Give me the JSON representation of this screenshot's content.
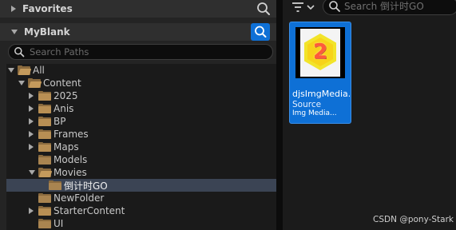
{
  "favorites": {
    "title": "Favorites"
  },
  "myblank": {
    "title": "MyBlank"
  },
  "path_search": {
    "placeholder": "Search Paths"
  },
  "tree": [
    {
      "label": "All",
      "indent": 0,
      "expanded": true,
      "has_arrow": true,
      "selected": false
    },
    {
      "label": "Content",
      "indent": 1,
      "expanded": true,
      "has_arrow": true,
      "selected": false
    },
    {
      "label": "2025",
      "indent": 2,
      "expanded": false,
      "has_arrow": true,
      "selected": false
    },
    {
      "label": "Anis",
      "indent": 2,
      "expanded": false,
      "has_arrow": true,
      "selected": false
    },
    {
      "label": "BP",
      "indent": 2,
      "expanded": false,
      "has_arrow": true,
      "selected": false
    },
    {
      "label": "Frames",
      "indent": 2,
      "expanded": false,
      "has_arrow": true,
      "selected": false
    },
    {
      "label": "Maps",
      "indent": 2,
      "expanded": false,
      "has_arrow": true,
      "selected": false
    },
    {
      "label": "Models",
      "indent": 2,
      "expanded": false,
      "has_arrow": false,
      "selected": false
    },
    {
      "label": "Movies",
      "indent": 2,
      "expanded": true,
      "has_arrow": true,
      "selected": false
    },
    {
      "label": "倒计时GO",
      "indent": 3,
      "expanded": false,
      "has_arrow": false,
      "selected": true
    },
    {
      "label": "NewFolder",
      "indent": 2,
      "expanded": false,
      "has_arrow": false,
      "selected": false
    },
    {
      "label": "StarterContent",
      "indent": 2,
      "expanded": false,
      "has_arrow": true,
      "selected": false
    },
    {
      "label": "UI",
      "indent": 2,
      "expanded": false,
      "has_arrow": false,
      "selected": false
    }
  ],
  "asset_search": {
    "placeholder": "Search 倒计时GO"
  },
  "asset": {
    "name": "djsImgMedia...",
    "type": "Source",
    "class": "Img Media...",
    "thumbnail_digit": "2"
  },
  "watermark": "CSDN @pony-Stark",
  "colors": {
    "accent": "#0e70d6",
    "folder": "#b88f54",
    "selection": "#3b4454"
  },
  "icons": [
    "search-icon",
    "filter-icon",
    "chevron-down-icon",
    "folder-icon",
    "folder-open-icon"
  ]
}
